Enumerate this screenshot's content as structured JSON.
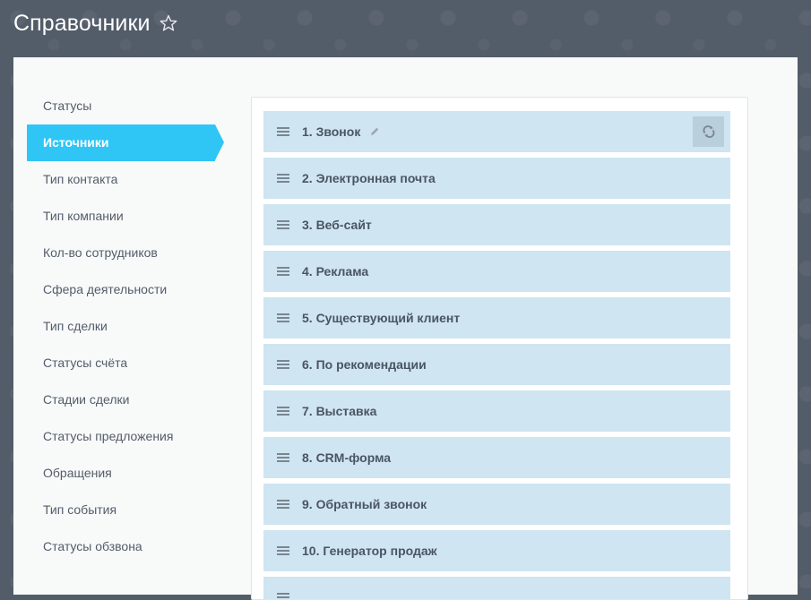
{
  "header": {
    "title": "Справочники",
    "favorite_icon": "star-icon"
  },
  "sidebar": {
    "items": [
      {
        "label": "Статусы"
      },
      {
        "label": "Источники",
        "active": true
      },
      {
        "label": "Тип контакта"
      },
      {
        "label": "Тип компании"
      },
      {
        "label": "Кол-во сотрудников"
      },
      {
        "label": "Сфера деятельности"
      },
      {
        "label": "Тип сделки"
      },
      {
        "label": "Статусы счёта"
      },
      {
        "label": "Стадии сделки"
      },
      {
        "label": "Статусы предложения"
      },
      {
        "label": "Обращения"
      },
      {
        "label": "Тип события"
      },
      {
        "label": "Статусы обзвона"
      }
    ]
  },
  "list": {
    "items": [
      {
        "label": "1. Звонок"
      },
      {
        "label": "2. Электронная почта"
      },
      {
        "label": "3. Веб-сайт"
      },
      {
        "label": "4. Реклама"
      },
      {
        "label": "5. Существующий клиент"
      },
      {
        "label": "6. По рекомендации"
      },
      {
        "label": "7. Выставка"
      },
      {
        "label": "8. CRM-форма"
      },
      {
        "label": "9. Обратный звонок"
      },
      {
        "label": "10. Генератор продаж"
      },
      {
        "label": ""
      }
    ]
  },
  "colors": {
    "background": "#535c69",
    "accent": "#2fc6f6",
    "row_bg": "#cfe5f1"
  }
}
